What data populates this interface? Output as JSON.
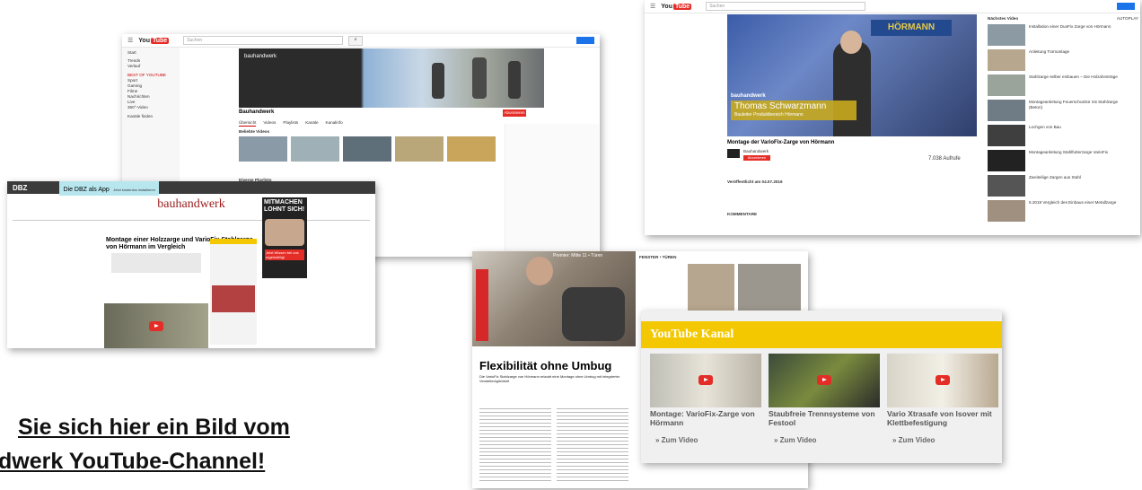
{
  "yt_channel": {
    "logo_you": "You",
    "logo_tube": "Tube",
    "search_placeholder": "Suchen",
    "channel_name": "bauhandwerk",
    "channel_title": "Bauhandwerk",
    "tabs": [
      "Übersicht",
      "Videos",
      "Playlists",
      "Kanäle",
      "Kanalinfo"
    ],
    "section_popular": "Beliebte Videos",
    "section_playlists": "Diverse Playlists",
    "subscribe": "Abonnieren",
    "sidebar": [
      "Start",
      "Trends",
      "Verlauf",
      "Sport",
      "Gaming",
      "Filme",
      "Nachrichten",
      "Live",
      "360°-Video",
      "Kanäle finden"
    ],
    "sidebar_head": "BEST OF YOUTUBE"
  },
  "yt_watch": {
    "search_placeholder": "Suchen",
    "next_label": "Nächstes Video",
    "autoplay": "AUTOPLAY",
    "video_title": "Montage der VarioFix-Zarge von Hörmann",
    "channel": "Bauhandwerk",
    "subscribe": "Abonnieren",
    "views": "7.038 Aufrufe",
    "lower_third_name": "Thomas Schwarzmann",
    "lower_third_sub": "Bauleiter Produktbereich Hörmann",
    "lower_third_brand": "bauhandwerk",
    "published": "Veröffentlicht am 04.07.2016",
    "comments": "KOMMENTARE",
    "related": [
      "Installation einer DuoFix Zarge von Hörmann",
      "Anleitung Türmontage",
      "Stahlzarge selber einbauen – Die Holzahnsträge",
      "Montageanleitung Feuerschutztür mit Stahlzarge (Beton)",
      "Lochgen von Bau",
      "Montageanleitung Stahlfutterzarge VarioFix",
      "Zweiteilige Zargen aus Stahl",
      "5.2019 Vergleich des Einbaus einer Metallzarge"
    ]
  },
  "website": {
    "logo_small": "DBZ",
    "ad_line1": "Die DBZ als App",
    "ad_line2": "Jetzt kostenlos installieren",
    "brand": "bauhandwerk",
    "article_title": "Montage einer Holzzarge und VarioFix Stahlzarge von Hörmann im Vergleich",
    "ad_headline": "MITMACHEN LOHNT SICH!",
    "ad_button": "Jetzt Wissen bei uns regelmäßig!"
  },
  "magazine": {
    "header": "Premier: Mitte 11 • Türen",
    "headline": "Flexibilität ohne Umbug",
    "lead": "Die VarioFix Stahlzarge von Hörmann erlaubt eine Montage ohne Umbug mit integrierter Verstellmöglichkeit",
    "panel_title": "YouTube Kanal",
    "videos": [
      {
        "title": "Montage: VarioFix-Zarge von Hörmann",
        "link": "» Zum Video"
      },
      {
        "title": "Staubfreie Trennsysteme von Festool",
        "link": "» Zum Video"
      },
      {
        "title": "Vario Xtrasafe von Isover mit Klettbefestigung",
        "link": "» Zum Video"
      }
    ],
    "top_label": "FENSTER • TÜREN",
    "colors": {
      "panel_yellow": "#f4c800",
      "panel_bg": "#f0f0f0"
    }
  },
  "caption": {
    "line1": "Sie sich hier ein Bild vom",
    "line2": "dwerk YouTube-Channel!"
  }
}
